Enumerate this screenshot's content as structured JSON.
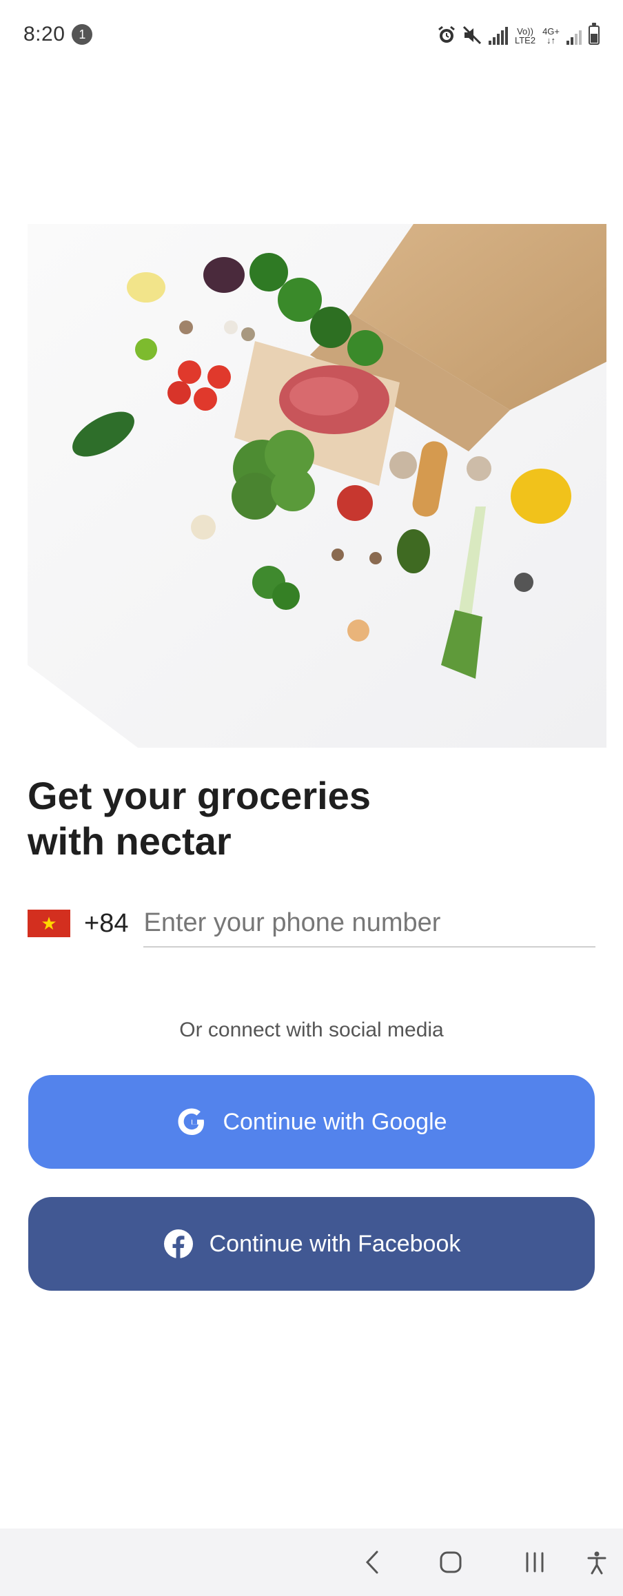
{
  "status_bar": {
    "time": "8:20",
    "notification_count": "1",
    "icons": [
      "alarm-icon",
      "mute-icon",
      "signal-icon",
      "volte-icon",
      "4g-icon",
      "signal-weak-icon",
      "battery-icon"
    ],
    "volte_label_top": "Vo))",
    "volte_label_bottom": "LTE2",
    "network_label": "4G+"
  },
  "hero": {
    "image": "groceries-illustration"
  },
  "title": "Get your groceries\nwith nectar",
  "phone": {
    "country_flag": "vietnam-flag",
    "dial_code": "+84",
    "placeholder": "Enter your phone number",
    "value": ""
  },
  "social": {
    "caption": "Or connect with social media",
    "google_label": "Continue with Google",
    "facebook_label": "Continue with Facebook",
    "google_color": "#5383ec",
    "facebook_color": "#415893"
  },
  "nav_bar": {
    "icons": [
      "back-icon",
      "home-icon",
      "recent-apps-icon",
      "accessibility-icon"
    ]
  }
}
